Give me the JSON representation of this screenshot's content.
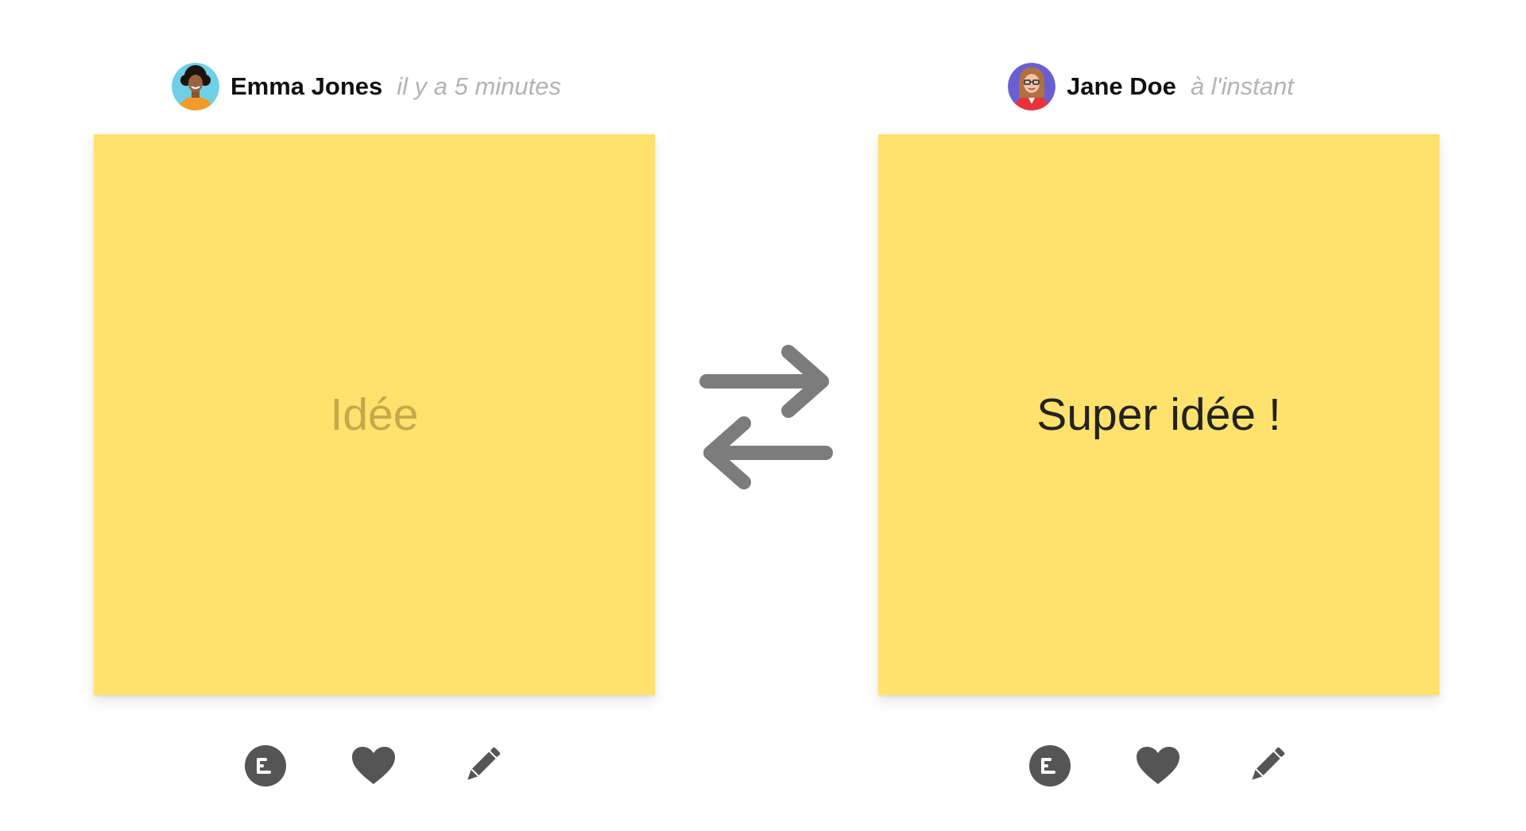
{
  "cards": {
    "left": {
      "author_name": "Emma Jones",
      "timestamp": "il y a 5 minutes",
      "note_text": "Idée",
      "note_state": "placeholder"
    },
    "right": {
      "author_name": "Jane Doe",
      "timestamp": "à l'instant",
      "note_text": "Super idée !",
      "note_state": "filled"
    }
  },
  "icons": {
    "comment": "comment-icon",
    "like": "heart-icon",
    "edit": "pencil-icon",
    "swap": "swap-arrows-icon"
  },
  "colors": {
    "sticky": "#fee26d",
    "placeholder_text": "#c2aa4c",
    "note_text": "#222222",
    "author_name": "#111111",
    "timestamp": "#b3b3b3",
    "icon": "#555555",
    "swap_arrows": "#7c7c7c"
  }
}
